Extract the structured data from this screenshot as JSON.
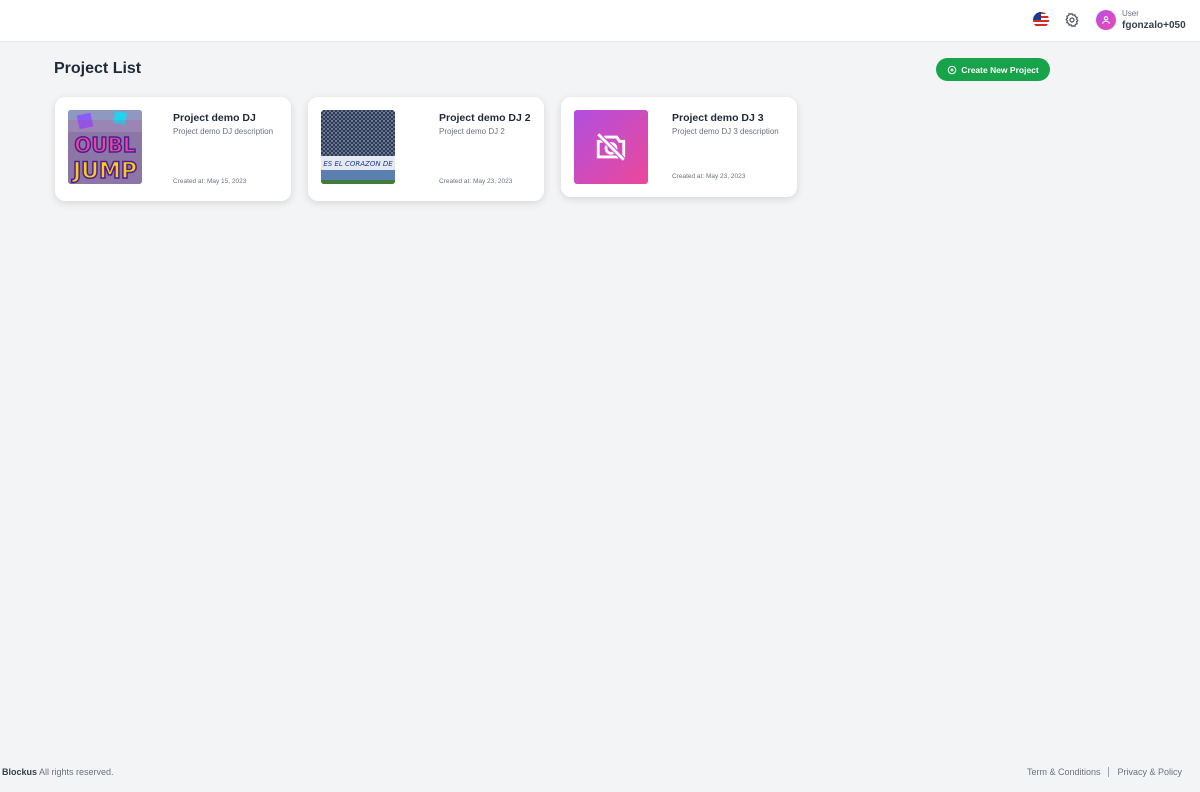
{
  "header": {
    "language_icon": "us-flag-icon",
    "settings_icon": "gear-icon",
    "user": {
      "role": "User",
      "name": "fgonzalo+050"
    }
  },
  "main": {
    "title": "Project List",
    "create_button_label": "Create New Project",
    "accent_color": "#16a34a",
    "projects": [
      {
        "name": "Project demo DJ",
        "description": "Project demo DJ description",
        "created": "Created at: May 15, 2023",
        "thumb_text_top": "OUBL",
        "thumb_text_bottom": "JUMP"
      },
      {
        "name": "Project demo DJ 2",
        "description": "Project demo DJ 2",
        "created": "Created at: May 23, 2023",
        "thumb_banner": "ES EL CORAZON DE"
      },
      {
        "name": "Project demo DJ 3",
        "description": "Project demo DJ 3 description",
        "created": "Created at: May 23, 2023",
        "thumb_icon": "no-image-icon"
      }
    ]
  },
  "footer": {
    "brand": "Blockus",
    "rights": " All rights reserved.",
    "terms": "Term & Conditions",
    "privacy": "Privacy & Policy"
  }
}
